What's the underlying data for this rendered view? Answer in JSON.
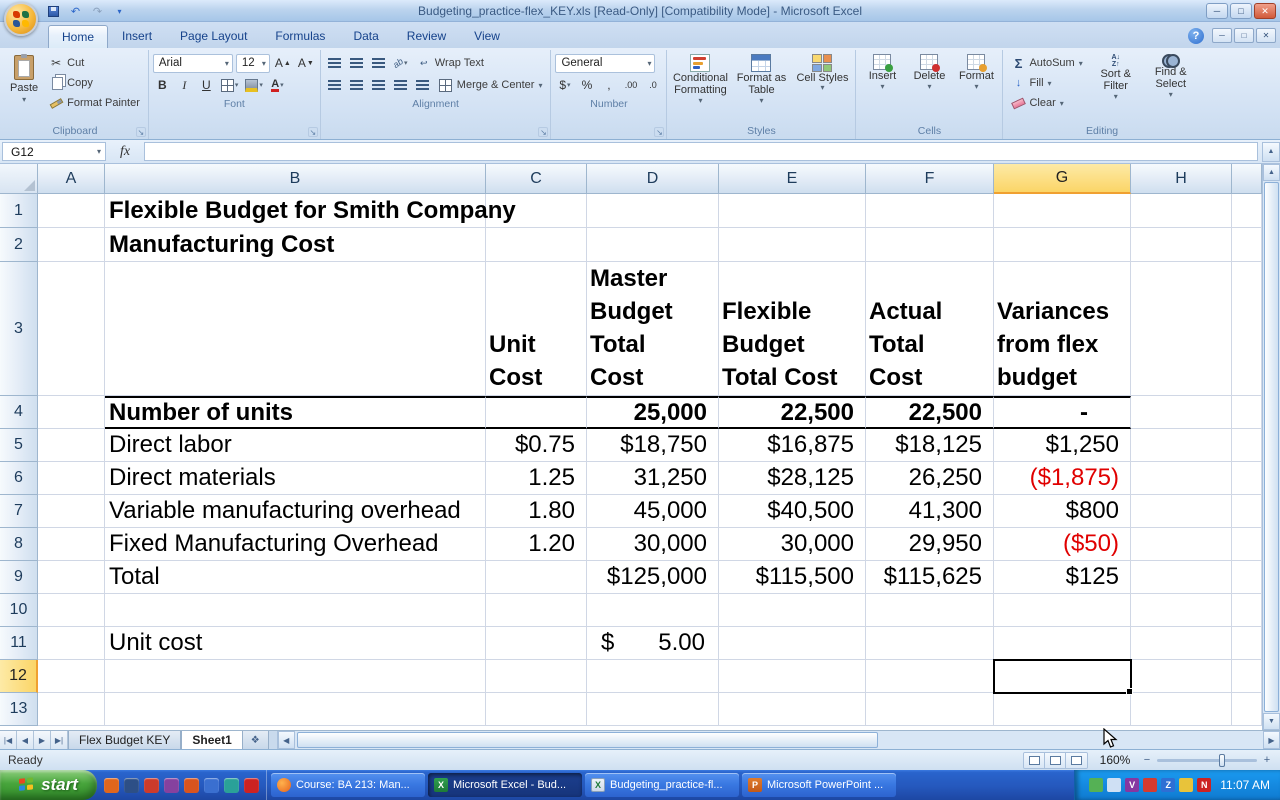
{
  "titlebar": {
    "title": "Budgeting_practice-flex_KEY.xls  [Read-Only]  [Compatibility Mode] - Microsoft Excel"
  },
  "ribbon": {
    "tabs": [
      {
        "label": "Home",
        "active": true
      },
      {
        "label": "Insert"
      },
      {
        "label": "Page Layout"
      },
      {
        "label": "Formulas"
      },
      {
        "label": "Data"
      },
      {
        "label": "Review"
      },
      {
        "label": "View"
      }
    ],
    "clipboard": {
      "group": "Clipboard",
      "paste": "Paste",
      "cut": "Cut",
      "copy": "Copy",
      "format_painter": "Format Painter"
    },
    "font": {
      "group": "Font",
      "name": "Arial",
      "size": "12",
      "bold": "B",
      "italic": "I",
      "underline": "U"
    },
    "alignment": {
      "group": "Alignment",
      "wrap": "Wrap Text",
      "merge": "Merge & Center"
    },
    "number": {
      "group": "Number",
      "format": "General",
      "currency": "$",
      "percent": "%",
      "comma": ",",
      "increase_decimal": ".00",
      "decrease_decimal": ".0"
    },
    "styles": {
      "group": "Styles",
      "conditional": "Conditional Formatting",
      "format_table": "Format as Table",
      "cell_styles": "Cell Styles"
    },
    "cells": {
      "group": "Cells",
      "insert": "Insert",
      "delete": "Delete",
      "format": "Format"
    },
    "editing": {
      "group": "Editing",
      "autosum": "AutoSum",
      "fill": "Fill",
      "clear": "Clear",
      "sort": "Sort & Filter",
      "find": "Find & Select"
    },
    "help": "?"
  },
  "formula_bar": {
    "name_box": "G12",
    "fx": "fx",
    "content": ""
  },
  "grid": {
    "columns": [
      "A",
      "B",
      "C",
      "D",
      "E",
      "F",
      "G",
      "H"
    ],
    "row_numbers": [
      "1",
      "2",
      "3",
      "4",
      "5",
      "6",
      "7",
      "8",
      "9",
      "10",
      "11",
      "12",
      "13"
    ],
    "selected_column": "G",
    "selected_row": "12",
    "selected_cell": "G12"
  },
  "sheet": {
    "titles": [
      {
        "cell": "B1",
        "text": "Flexible Budget for Smith Company"
      },
      {
        "cell": "B2",
        "text": "Manufacturing Cost"
      }
    ],
    "header_row3": {
      "C": "Unit\nCost",
      "D": "Master\nBudget\nTotal\nCost",
      "E": "Flexible\nBudget\nTotal Cost",
      "F": "Actual\nTotal\nCost",
      "G": "Variances\nfrom flex\nbudget"
    },
    "rows": [
      {
        "row": 4,
        "label": "Number of units",
        "bold": true,
        "values": {
          "D": "25,000",
          "E": "22,500",
          "F": "22,500",
          "G": "-"
        }
      },
      {
        "row": 5,
        "label": "Direct labor",
        "values": {
          "C": "$0.75",
          "D": "$18,750",
          "E": "$16,875",
          "F": "$18,125",
          "G": "$1,250"
        }
      },
      {
        "row": 6,
        "label": "Direct materials",
        "values": {
          "C": "1.25",
          "D": "31,250",
          "E": "$28,125",
          "F": "26,250",
          "G": "($1,875)"
        },
        "red": [
          "G"
        ]
      },
      {
        "row": 7,
        "label": "Variable manufacturing overhead",
        "values": {
          "C": "1.80",
          "D": "45,000",
          "E": "$40,500",
          "F": "41,300",
          "G": "$800"
        }
      },
      {
        "row": 8,
        "label": "Fixed Manufacturing Overhead",
        "values": {
          "C": "1.20",
          "D": "30,000",
          "E": "30,000",
          "F": "29,950",
          "G": "($50)"
        },
        "red": [
          "G"
        ]
      },
      {
        "row": 9,
        "label": "Total",
        "values": {
          "D": "$125,000",
          "E": "$115,500",
          "F": "$115,625",
          "G": "$125"
        }
      },
      {
        "row": 11,
        "label": "Unit cost",
        "accounting": {
          "col": "D",
          "symbol": "$",
          "value": "5.00"
        }
      }
    ]
  },
  "sheet_tabs": {
    "tabs": [
      {
        "name": "Flex Budget KEY"
      },
      {
        "name": "Sheet1",
        "active": true
      }
    ]
  },
  "status_bar": {
    "mode": "Ready",
    "zoom": "160%"
  },
  "taskbar": {
    "start_label": "start",
    "quick_launch": [
      "#e0661c",
      "#2d4f86",
      "#cc3b2b",
      "#86419e",
      "#d8541e",
      "#3a6fd0",
      "#2aa198",
      "#cc2222"
    ],
    "windows": [
      {
        "label": "Course: BA 213: Man...",
        "icon": "firefox-icon"
      },
      {
        "label": "Microsoft Excel - Bud...",
        "icon": "excel-icon",
        "active": true
      },
      {
        "label": "Budgeting_practice-fl...",
        "icon": "excel-doc-icon"
      },
      {
        "label": "Microsoft PowerPoint ...",
        "icon": "powerpoint-icon"
      }
    ],
    "tray_icons": [
      {
        "color": "#55b155",
        "letter": ""
      },
      {
        "color": "#cfe0f4",
        "letter": ""
      },
      {
        "color": "#8637a0",
        "letter": "V"
      },
      {
        "color": "#d43b2f",
        "letter": ""
      },
      {
        "color": "#2e6fd4",
        "letter": "Z"
      },
      {
        "color": "#e8c33a",
        "letter": ""
      },
      {
        "color": "#cc2222",
        "letter": "N"
      }
    ],
    "clock": "11:07 AM"
  }
}
